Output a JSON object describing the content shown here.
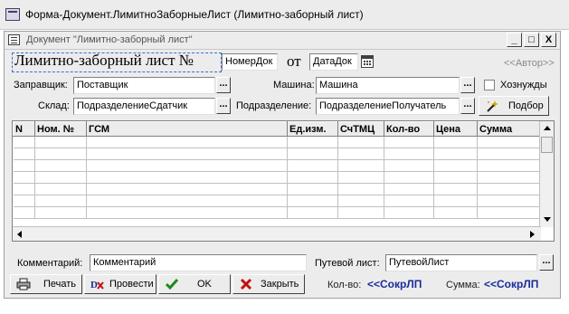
{
  "window": {
    "title": "Форма-Документ.ЛимитноЗаборныеЛист (Лимитно-заборный лист)"
  },
  "document": {
    "title": "Документ \"Лимитно-заборный лист\"",
    "buttons": {
      "minimize": "_",
      "maximize": "□",
      "close": "X"
    },
    "heading": "Лимитно-заборный лист №",
    "number_value": "НомерДок",
    "from_label": "от",
    "date_value": "ДатаДок",
    "author_link": "<<Автор>>"
  },
  "form": {
    "supplier": {
      "label": "Заправщик:",
      "value": "Поставщик"
    },
    "vehicle": {
      "label": "Машина:",
      "value": "Машина"
    },
    "household": {
      "label": "Хознужды",
      "checked": false
    },
    "warehouse": {
      "label": "Склад:",
      "value": "ПодразделениеСдатчик"
    },
    "department": {
      "label": "Подразделение:",
      "value": "ПодразделениеПолучатель"
    },
    "select_button": "Подбор",
    "dots": "..."
  },
  "table": {
    "columns": [
      "N",
      "Ном. №",
      "ГСМ",
      "Ед.изм.",
      "СчТМЦ",
      "Кол-во",
      "Цена",
      "Сумма"
    ],
    "rows": [
      [],
      [],
      [],
      [],
      [],
      [],
      [],
      []
    ]
  },
  "footer": {
    "comment": {
      "label": "Комментарий:",
      "value": "Комментарий"
    },
    "waybill": {
      "label": "Путевой лист:",
      "value": "ПутевойЛист"
    },
    "buttons": {
      "print": "Печать",
      "post": "Провести",
      "ok": "OK",
      "close": "Закрыть"
    },
    "qty_label": "Кол-во:",
    "qty_value": "<<СокрЛП",
    "sum_label": "Сумма:",
    "sum_value": "<<СокрЛП"
  },
  "colors": {
    "accent_blue": "#1a2c9a",
    "selection_border": "#3a6fd0",
    "ok_green": "#1a8a1a",
    "close_red": "#c01010"
  }
}
